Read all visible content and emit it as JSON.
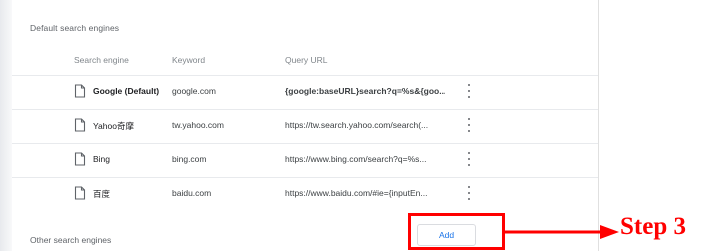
{
  "section_title": "Default search engines",
  "columns": {
    "engine": "Search engine",
    "keyword": "Keyword",
    "url": "Query URL"
  },
  "rows": [
    {
      "name": "Google (Default)",
      "keyword": "google.com",
      "url": "{google:baseURL}search?q=%s&{goo...",
      "bold": true
    },
    {
      "name": "Yahoo奇摩",
      "keyword": "tw.yahoo.com",
      "url": "https://tw.search.yahoo.com/search(...",
      "bold": false
    },
    {
      "name": "Bing",
      "keyword": "bing.com",
      "url": "https://www.bing.com/search?q=%s...",
      "bold": false
    },
    {
      "name": "百度",
      "keyword": "baidu.com",
      "url": "https://www.baidu.com/#ie={inputEn...",
      "bold": false
    }
  ],
  "other_title": "Other search engines",
  "add_label": "Add",
  "annotation": {
    "label": "Step 3",
    "color": "#ff0000"
  },
  "icons": {
    "engine_icon": "page-icon",
    "menu_icon": "more-vert-icon",
    "arrow": "arrow-right-icon"
  }
}
